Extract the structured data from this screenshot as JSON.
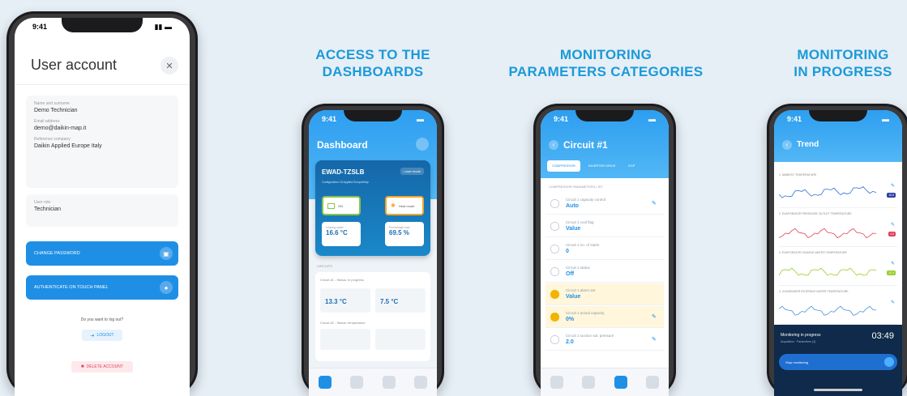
{
  "captions": {
    "dashboards": [
      "ACCESS TO THE",
      "DASHBOARDS"
    ],
    "categories": [
      "MONITORING",
      "PARAMETERS CATEGORIES"
    ],
    "progress": [
      "MONITORING",
      "IN PROGRESS"
    ]
  },
  "status_time": "9:41",
  "user_account": {
    "title": "User account",
    "close_icon": "close-icon",
    "fields": [
      {
        "label": "Name and surname",
        "value": "Demo Technician"
      },
      {
        "label": "Email address",
        "value": "demo@daikin-map.it"
      },
      {
        "label": "Reference company",
        "value": "Daikin Applied Europe Italy"
      }
    ],
    "role": {
      "label": "User role",
      "value": "Technician"
    },
    "change_password": "CHANGE PASSWORD",
    "authenticate": "AUTHENTICATE ON TOUCH PANEL",
    "logout_prompt": "Do you want to log out?",
    "logout": "LOGOUT",
    "delete_account": "DELETE ACCOUNT"
  },
  "dashboard": {
    "title": "Dashboard",
    "unit_name": "EWAD-TZSLB",
    "unit_badge": "• user mode",
    "unit_sub": "Configuration 18 Applied Europe/Italy",
    "on_label": "ON",
    "mode_label": "Heat mode",
    "temp1": "16.6 °C",
    "temp1_label": "Leaving water",
    "temp2": "69.5 %",
    "temp2_label": "Percentage load",
    "section": "CIRCUITS",
    "c1": "Circuit #1 - Status: in progress",
    "c1_v1": "13.3 °C",
    "c1_v2": "7.5 °C",
    "c2": "Circuit #2 - Status: temperature"
  },
  "circuit": {
    "title": "Circuit #1",
    "tabs": [
      "COMPRESSOR",
      "INVERTER DRIVE",
      "EXP"
    ],
    "section": "COMPRESSOR PARAMETERS LIST",
    "rows": [
      {
        "label": "Circuit 1 capacity control",
        "value": "Auto",
        "hl": false,
        "pen": true
      },
      {
        "label": "Circuit 1 cool flag",
        "value": "Value",
        "hl": false,
        "pen": false
      },
      {
        "label": "Circuit 1 no. of starts",
        "value": "0",
        "hl": false,
        "pen": false
      },
      {
        "label": "Circuit 1 status",
        "value": "Off",
        "hl": false,
        "pen": false
      },
      {
        "label": "Circuit 1 alarm set",
        "value": "Value",
        "hl": true,
        "pen": false
      },
      {
        "label": "Circuit 1 actual capacity",
        "value": "0%",
        "hl": true,
        "pen": true
      },
      {
        "label": "Circuit 1 suction sat. pressure",
        "value": "2.0",
        "hl": false,
        "pen": true
      }
    ]
  },
  "trend": {
    "title": "Trend",
    "charts": [
      {
        "label": "1. AMBIENT TEMPERATURE",
        "color": "#2f6fd6",
        "badge": "18.8",
        "badge_color": "#2c3e9e"
      },
      {
        "label": "2. EVAPORATOR PRESSURE OUTLET TEMPERATURE",
        "color": "#e0405a",
        "badge": "4.3",
        "badge_color": "#e0405a"
      },
      {
        "label": "3. EVAPORATOR LEAVING WATER TEMPERATURE",
        "color": "#9acd32",
        "badge": "12.4",
        "badge_color": "#9acd32"
      },
      {
        "label": "4. CONDENSER ENTERING WATER TEMPERATURE",
        "color": "#4a8fe0",
        "badge": "",
        "badge_color": "#4a8fe0"
      }
    ],
    "progress_label": "Monitoring in progress",
    "progress_sub": "Acquisition · Parameters (4)",
    "timer": "03:49",
    "stop_label": "Stop monitoring"
  }
}
